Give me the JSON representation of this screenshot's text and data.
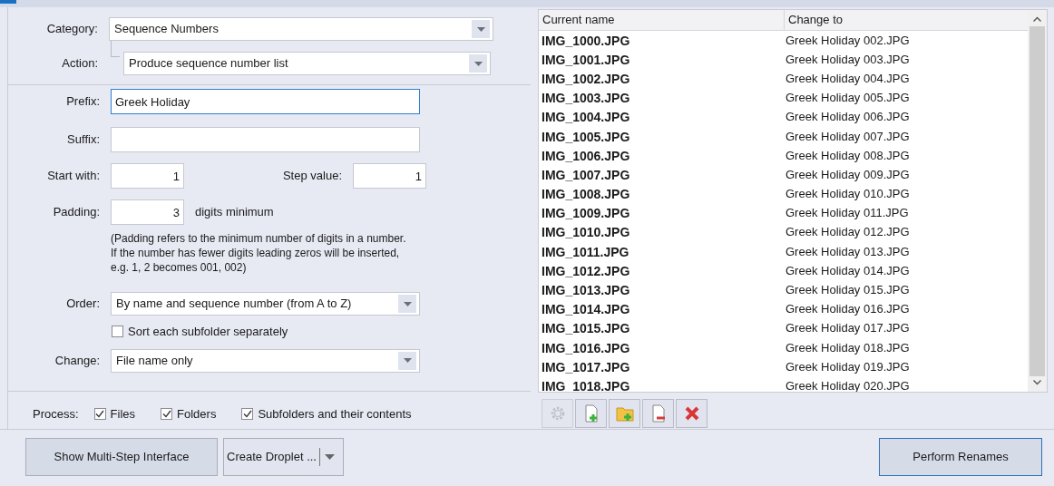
{
  "form": {
    "category": {
      "label": "Category:",
      "value": "Sequence Numbers"
    },
    "action": {
      "label": "Action:",
      "value": "Produce sequence number list"
    },
    "prefix": {
      "label": "Prefix:",
      "value": "Greek Holiday ",
      "focused": true
    },
    "suffix": {
      "label": "Suffix:"
    },
    "start_with": {
      "label": "Start with:",
      "value": "1"
    },
    "step_value": {
      "label": "Step value:",
      "value": "1"
    },
    "padding": {
      "label": "Padding:",
      "value": "3",
      "unit": "digits minimum"
    },
    "padding_note": "(Padding refers to the minimum number of digits in a number.\nIf the number has fewer digits leading zeros will be inserted,\ne.g. 1, 2 becomes 001, 002)",
    "order": {
      "label": "Order:",
      "value": "By name and sequence number (from A to Z)"
    },
    "sort_each_subfolder": {
      "label": "Sort each subfolder separately",
      "checked": false
    },
    "change": {
      "label": "Change:",
      "value": "File name only"
    }
  },
  "process": {
    "label": "Process:",
    "options": [
      {
        "label": "Files",
        "checked": true
      },
      {
        "label": "Folders",
        "checked": true
      },
      {
        "label": "Subfolders and their contents",
        "checked": true
      }
    ]
  },
  "table": {
    "columns": [
      "Current name",
      "Change to"
    ],
    "rows": [
      [
        "IMG_1000.JPG",
        "Greek Holiday 002.JPG"
      ],
      [
        "IMG_1001.JPG",
        "Greek Holiday 003.JPG"
      ],
      [
        "IMG_1002.JPG",
        "Greek Holiday 004.JPG"
      ],
      [
        "IMG_1003.JPG",
        "Greek Holiday 005.JPG"
      ],
      [
        "IMG_1004.JPG",
        "Greek Holiday 006.JPG"
      ],
      [
        "IMG_1005.JPG",
        "Greek Holiday 007.JPG"
      ],
      [
        "IMG_1006.JPG",
        "Greek Holiday 008.JPG"
      ],
      [
        "IMG_1007.JPG",
        "Greek Holiday 009.JPG"
      ],
      [
        "IMG_1008.JPG",
        "Greek Holiday 010.JPG"
      ],
      [
        "IMG_1009.JPG",
        "Greek Holiday 011.JPG"
      ],
      [
        "IMG_1010.JPG",
        "Greek Holiday 012.JPG"
      ],
      [
        "IMG_1011.JPG",
        "Greek Holiday 013.JPG"
      ],
      [
        "IMG_1012.JPG",
        "Greek Holiday 014.JPG"
      ],
      [
        "IMG_1013.JPG",
        "Greek Holiday 015.JPG"
      ],
      [
        "IMG_1014.JPG",
        "Greek Holiday 016.JPG"
      ],
      [
        "IMG_1015.JPG",
        "Greek Holiday 017.JPG"
      ],
      [
        "IMG_1016.JPG",
        "Greek Holiday 018.JPG"
      ],
      [
        "IMG_1017.JPG",
        "Greek Holiday 019.JPG"
      ],
      [
        "IMG_1018.JPG",
        "Greek Holiday 020.JPG"
      ]
    ]
  },
  "toolbar": [
    {
      "kind": "settings",
      "disabled": true
    },
    {
      "kind": "add-file",
      "disabled": false
    },
    {
      "kind": "add-folder",
      "disabled": false
    },
    {
      "kind": "remove",
      "disabled": false
    },
    {
      "kind": "clear",
      "disabled": false
    }
  ],
  "buttons": {
    "multi_step": "Show Multi-Step Interface",
    "droplet": "Create Droplet ...",
    "perform": "Perform Renames"
  }
}
